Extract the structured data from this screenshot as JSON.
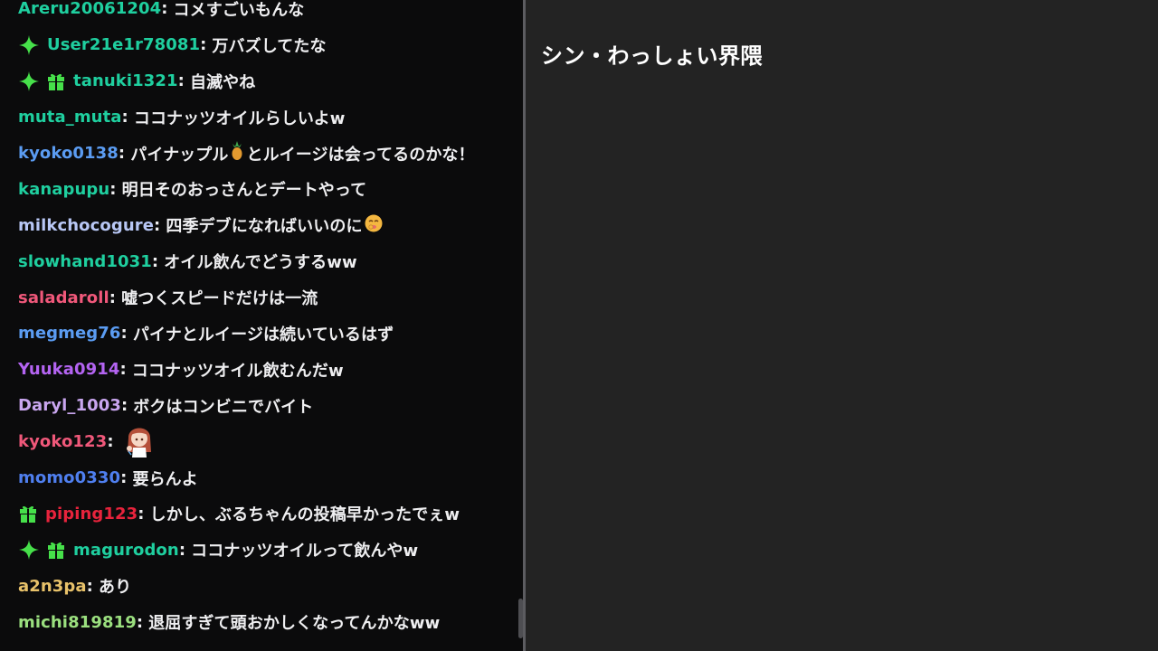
{
  "chat": {
    "messages": [
      {
        "user": "Areru20061204",
        "color": "#1fcf9f",
        "badges": [],
        "text": "コメすごいもんな",
        "emoji": null
      },
      {
        "user": "User21e1r78081",
        "color": "#1fcf9f",
        "badges": [
          "sparkle-badge"
        ],
        "text": "万バズしてたな",
        "emoji": null
      },
      {
        "user": "tanuki1321",
        "color": "#1fcf9f",
        "badges": [
          "sparkle-badge",
          "gift-badge"
        ],
        "text": "自滅やね",
        "emoji": null
      },
      {
        "user": "muta_muta",
        "color": "#1fcf9f",
        "badges": [],
        "text": "ココナッツオイルらしいよw",
        "emoji": null
      },
      {
        "user": "kyoko0138",
        "color": "#5b9cf2",
        "badges": [],
        "text": "パイナップル",
        "emoji": "pineapple",
        "text_after": "とルイージは会ってるのかな！"
      },
      {
        "user": "kanapupu",
        "color": "#1fcf9f",
        "badges": [],
        "text": "明日そのおっさんとデートやって",
        "emoji": null
      },
      {
        "user": "milkchocogure",
        "color": "#b8c7f5",
        "badges": [],
        "text": "四季デブになればいいのに",
        "emoji": "smirk-face"
      },
      {
        "user": "slowhand1031",
        "color": "#1fcf9f",
        "badges": [],
        "text": "オイル飲んでどうするww",
        "emoji": null
      },
      {
        "user": "saladaroll",
        "color": "#f0587a",
        "badges": [],
        "text": "嘘つくスピードだけは一流",
        "emoji": null
      },
      {
        "user": "megmeg76",
        "color": "#5b9cf2",
        "badges": [],
        "text": "パイナとルイージは続いているはず",
        "emoji": null
      },
      {
        "user": "Yuuka0914",
        "color": "#b464f2",
        "badges": [],
        "text": "ココナッツオイル飲むんだw",
        "emoji": null
      },
      {
        "user": "Daryl_1003",
        "color": "#c9a6ef",
        "badges": [],
        "text": "ボクはコンビニでバイト",
        "emoji": null
      },
      {
        "user": "kyoko123",
        "color": "#f0587a",
        "badges": [],
        "text": "",
        "emoji": "chibi-girl-wave"
      },
      {
        "user": "momo0330",
        "color": "#4f7fef",
        "badges": [],
        "text": "要らんよ",
        "emoji": null
      },
      {
        "user": "piping123",
        "color": "#e8233c",
        "badges": [
          "gift-badge"
        ],
        "text": "しかし、ぶるちゃんの投稿早かったでぇw",
        "emoji": null
      },
      {
        "user": "magurodon",
        "color": "#1fcf9f",
        "badges": [
          "sparkle-badge",
          "gift-badge"
        ],
        "text": "ココナッツオイルって飲んやw",
        "emoji": null
      },
      {
        "user": "a2n3pa",
        "color": "#e8c26a",
        "badges": [],
        "text": "あり",
        "emoji": null
      },
      {
        "user": "michi819819",
        "color": "#9be07f",
        "badges": [],
        "text": "退屈すぎて頭おかしくなってんかなww",
        "emoji": null
      }
    ]
  },
  "right_panel": {
    "title": "シン・わっしょい界隈"
  },
  "colors": {
    "chat_background": "#0b0b0c",
    "panel_background": "#232323",
    "badge_green": "#46e04a",
    "message_text": "#efeff1"
  }
}
